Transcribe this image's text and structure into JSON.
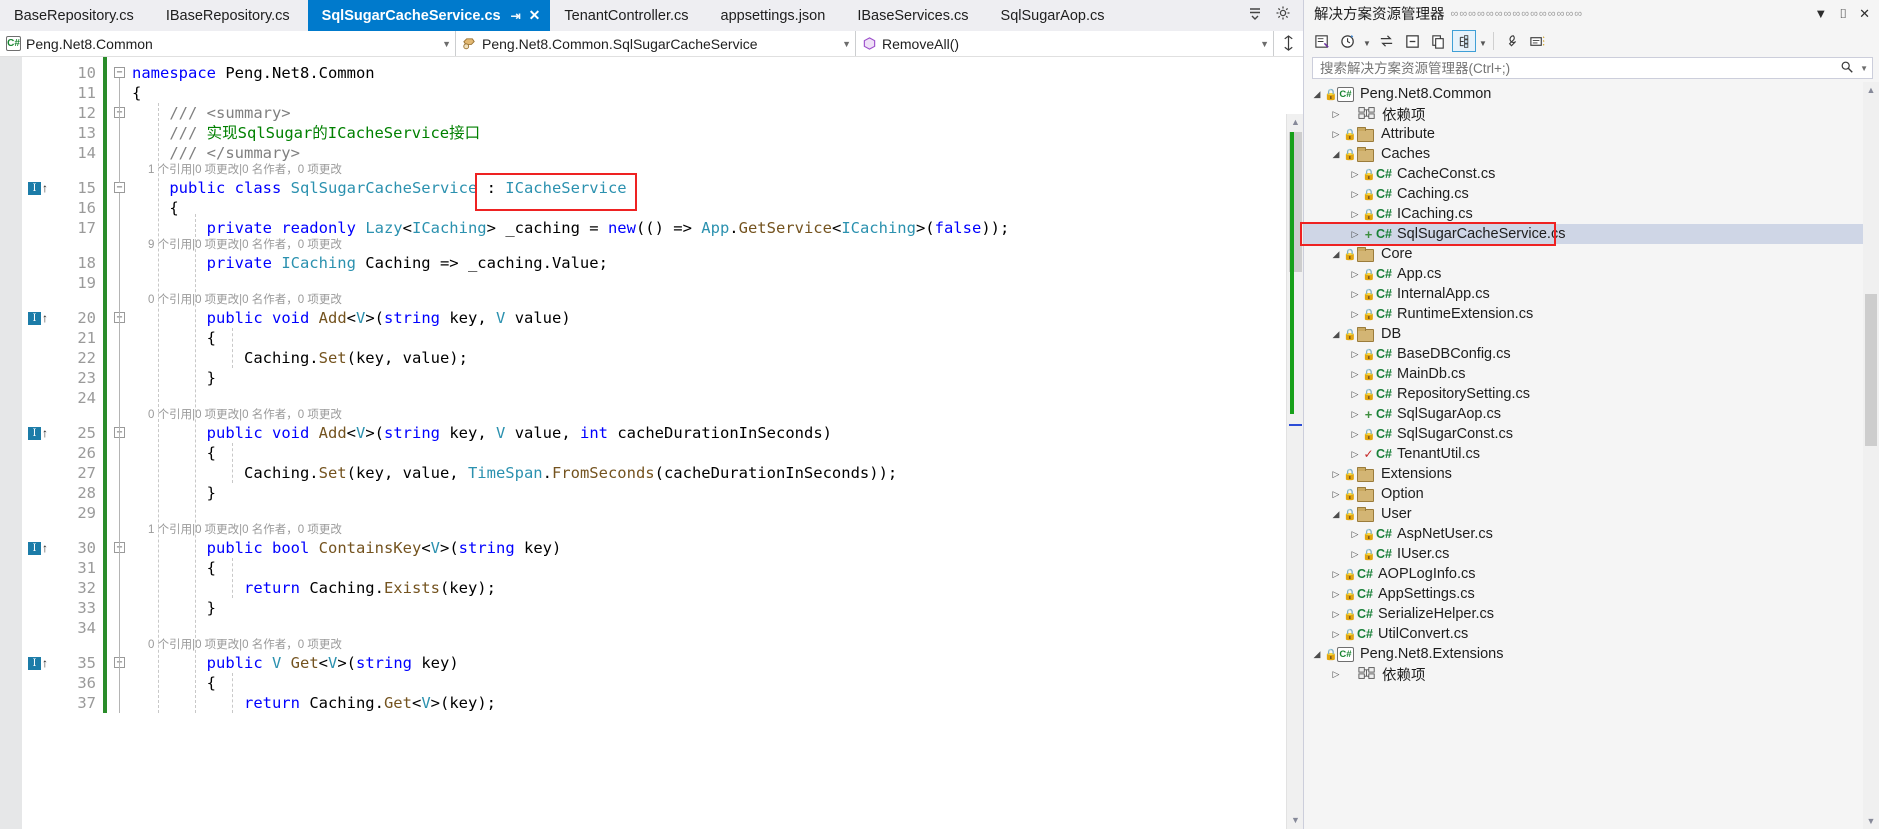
{
  "tabs": [
    {
      "label": "BaseRepository.cs",
      "active": false
    },
    {
      "label": "IBaseRepository.cs",
      "active": false
    },
    {
      "label": "SqlSugarCacheService.cs",
      "active": true
    },
    {
      "label": "TenantController.cs",
      "active": false
    },
    {
      "label": "appsettings.json",
      "active": false
    },
    {
      "label": "IBaseServices.cs",
      "active": false
    },
    {
      "label": "SqlSugarAop.cs",
      "active": false
    }
  ],
  "tab_icons": {
    "pin": "pin-icon",
    "close": "close-icon",
    "overflow": "tab-overflow-icon",
    "settings": "gear-icon"
  },
  "navbar": {
    "project": "Peng.Net8.Common",
    "type": "Peng.Net8.Common.SqlSugarCacheService",
    "member": "RemoveAll()",
    "split_icon": "split-editor-icon"
  },
  "editor": {
    "first_line_number": 10,
    "lines": [
      {
        "n": 10,
        "indicator": false,
        "collapse": "minus",
        "tokens": [
          {
            "t": "namespace ",
            "c": "k"
          },
          {
            "t": "Peng.Net8.Common",
            "c": "pl"
          }
        ]
      },
      {
        "n": 11,
        "indicator": false,
        "collapse": "",
        "tokens": [
          {
            "t": "{",
            "c": "pl"
          }
        ]
      },
      {
        "n": 12,
        "indicator": false,
        "collapse": "minus",
        "tokens": [
          {
            "t": "    /// ",
            "c": "xd"
          },
          {
            "t": "<summary>",
            "c": "xd"
          }
        ]
      },
      {
        "n": 13,
        "indicator": false,
        "collapse": "",
        "tokens": [
          {
            "t": "    /// ",
            "c": "xd"
          },
          {
            "t": "实现SqlSugar的ICacheService接口",
            "c": "cm"
          }
        ]
      },
      {
        "n": 14,
        "indicator": false,
        "collapse": "",
        "tokens": [
          {
            "t": "    /// ",
            "c": "xd"
          },
          {
            "t": "</summary>",
            "c": "xd"
          }
        ]
      },
      {
        "n": 15,
        "indicator": true,
        "collapse": "minus",
        "lens": "1 个引用|0 项更改|0 名作者，0 项更改",
        "tokens": [
          {
            "t": "    ",
            "c": "pl"
          },
          {
            "t": "public ",
            "c": "k"
          },
          {
            "t": "class ",
            "c": "k"
          },
          {
            "t": "SqlSugarCacheService",
            "c": "t"
          },
          {
            "t": " : ",
            "c": "pl"
          },
          {
            "t": "ICacheService",
            "c": "t"
          }
        ]
      },
      {
        "n": 16,
        "indicator": false,
        "collapse": "",
        "tokens": [
          {
            "t": "    {",
            "c": "pl"
          }
        ]
      },
      {
        "n": 17,
        "indicator": false,
        "collapse": "",
        "tokens": [
          {
            "t": "        ",
            "c": "pl"
          },
          {
            "t": "private ",
            "c": "k"
          },
          {
            "t": "readonly ",
            "c": "k"
          },
          {
            "t": "Lazy",
            "c": "t"
          },
          {
            "t": "<",
            "c": "pl"
          },
          {
            "t": "ICaching",
            "c": "t"
          },
          {
            "t": "> ",
            "c": "pl"
          },
          {
            "t": "_caching",
            "c": "pl"
          },
          {
            "t": " = ",
            "c": "pl"
          },
          {
            "t": "new",
            "c": "k"
          },
          {
            "t": "(() => ",
            "c": "pl"
          },
          {
            "t": "App",
            "c": "t"
          },
          {
            "t": ".",
            "c": "pl"
          },
          {
            "t": "GetService",
            "c": "mn"
          },
          {
            "t": "<",
            "c": "pl"
          },
          {
            "t": "ICaching",
            "c": "t"
          },
          {
            "t": ">(",
            "c": "pl"
          },
          {
            "t": "false",
            "c": "k"
          },
          {
            "t": "));",
            "c": "pl"
          }
        ]
      },
      {
        "n": 18,
        "indicator": false,
        "collapse": "",
        "lens": "9 个引用|0 项更改|0 名作者，0 项更改",
        "tokens": [
          {
            "t": "        ",
            "c": "pl"
          },
          {
            "t": "private ",
            "c": "k"
          },
          {
            "t": "ICaching",
            "c": "t"
          },
          {
            "t": " Caching => ",
            "c": "pl"
          },
          {
            "t": "_caching.Value;",
            "c": "pl"
          }
        ]
      },
      {
        "n": 19,
        "indicator": false,
        "collapse": "",
        "tokens": []
      },
      {
        "n": 20,
        "indicator": true,
        "collapse": "minus",
        "lens": "0 个引用|0 项更改|0 名作者，0 项更改",
        "tokens": [
          {
            "t": "        ",
            "c": "pl"
          },
          {
            "t": "public ",
            "c": "k"
          },
          {
            "t": "void ",
            "c": "k"
          },
          {
            "t": "Add",
            "c": "mn"
          },
          {
            "t": "<",
            "c": "pl"
          },
          {
            "t": "V",
            "c": "t"
          },
          {
            "t": ">(",
            "c": "pl"
          },
          {
            "t": "string",
            "c": "k"
          },
          {
            "t": " key, ",
            "c": "pl"
          },
          {
            "t": "V",
            "c": "t"
          },
          {
            "t": " value)",
            "c": "pl"
          }
        ]
      },
      {
        "n": 21,
        "indicator": false,
        "collapse": "",
        "tokens": [
          {
            "t": "        {",
            "c": "pl"
          }
        ]
      },
      {
        "n": 22,
        "indicator": false,
        "collapse": "",
        "tokens": [
          {
            "t": "            Caching.",
            "c": "pl"
          },
          {
            "t": "Set",
            "c": "mn"
          },
          {
            "t": "(key, value);",
            "c": "pl"
          }
        ]
      },
      {
        "n": 23,
        "indicator": false,
        "collapse": "",
        "tokens": [
          {
            "t": "        }",
            "c": "pl"
          }
        ]
      },
      {
        "n": 24,
        "indicator": false,
        "collapse": "",
        "tokens": []
      },
      {
        "n": 25,
        "indicator": true,
        "collapse": "minus",
        "lens": "0 个引用|0 项更改|0 名作者，0 项更改",
        "tokens": [
          {
            "t": "        ",
            "c": "pl"
          },
          {
            "t": "public ",
            "c": "k"
          },
          {
            "t": "void ",
            "c": "k"
          },
          {
            "t": "Add",
            "c": "mn"
          },
          {
            "t": "<",
            "c": "pl"
          },
          {
            "t": "V",
            "c": "t"
          },
          {
            "t": ">(",
            "c": "pl"
          },
          {
            "t": "string",
            "c": "k"
          },
          {
            "t": " key, ",
            "c": "pl"
          },
          {
            "t": "V",
            "c": "t"
          },
          {
            "t": " value, ",
            "c": "pl"
          },
          {
            "t": "int",
            "c": "k"
          },
          {
            "t": " cacheDurationInSeconds)",
            "c": "pl"
          }
        ]
      },
      {
        "n": 26,
        "indicator": false,
        "collapse": "",
        "tokens": [
          {
            "t": "        {",
            "c": "pl"
          }
        ]
      },
      {
        "n": 27,
        "indicator": false,
        "collapse": "",
        "tokens": [
          {
            "t": "            Caching.",
            "c": "pl"
          },
          {
            "t": "Set",
            "c": "mn"
          },
          {
            "t": "(key, value, ",
            "c": "pl"
          },
          {
            "t": "TimeSpan",
            "c": "t"
          },
          {
            "t": ".",
            "c": "pl"
          },
          {
            "t": "FromSeconds",
            "c": "mn"
          },
          {
            "t": "(cacheDurationInSeconds));",
            "c": "pl"
          }
        ]
      },
      {
        "n": 28,
        "indicator": false,
        "collapse": "",
        "tokens": [
          {
            "t": "        }",
            "c": "pl"
          }
        ]
      },
      {
        "n": 29,
        "indicator": false,
        "collapse": "",
        "tokens": []
      },
      {
        "n": 30,
        "indicator": true,
        "collapse": "minus",
        "lens": "1 个引用|0 项更改|0 名作者，0 项更改",
        "tokens": [
          {
            "t": "        ",
            "c": "pl"
          },
          {
            "t": "public ",
            "c": "k"
          },
          {
            "t": "bool ",
            "c": "k"
          },
          {
            "t": "ContainsKey",
            "c": "mn"
          },
          {
            "t": "<",
            "c": "pl"
          },
          {
            "t": "V",
            "c": "t"
          },
          {
            "t": ">(",
            "c": "pl"
          },
          {
            "t": "string",
            "c": "k"
          },
          {
            "t": " key)",
            "c": "pl"
          }
        ]
      },
      {
        "n": 31,
        "indicator": false,
        "collapse": "",
        "tokens": [
          {
            "t": "        {",
            "c": "pl"
          }
        ]
      },
      {
        "n": 32,
        "indicator": false,
        "collapse": "",
        "tokens": [
          {
            "t": "            ",
            "c": "pl"
          },
          {
            "t": "return ",
            "c": "k"
          },
          {
            "t": "Caching.",
            "c": "pl"
          },
          {
            "t": "Exists",
            "c": "mn"
          },
          {
            "t": "(key);",
            "c": "pl"
          }
        ]
      },
      {
        "n": 33,
        "indicator": false,
        "collapse": "",
        "tokens": [
          {
            "t": "        }",
            "c": "pl"
          }
        ]
      },
      {
        "n": 34,
        "indicator": false,
        "collapse": "",
        "tokens": []
      },
      {
        "n": 35,
        "indicator": true,
        "collapse": "minus",
        "lens": "0 个引用|0 项更改|0 名作者，0 项更改",
        "tokens": [
          {
            "t": "        ",
            "c": "pl"
          },
          {
            "t": "public ",
            "c": "k"
          },
          {
            "t": "V ",
            "c": "t"
          },
          {
            "t": "Get",
            "c": "mn"
          },
          {
            "t": "<",
            "c": "pl"
          },
          {
            "t": "V",
            "c": "t"
          },
          {
            "t": ">(",
            "c": "pl"
          },
          {
            "t": "string",
            "c": "k"
          },
          {
            "t": " key)",
            "c": "pl"
          }
        ]
      },
      {
        "n": 36,
        "indicator": false,
        "collapse": "",
        "tokens": [
          {
            "t": "        {",
            "c": "pl"
          }
        ]
      },
      {
        "n": 37,
        "indicator": false,
        "collapse": "",
        "tokens": [
          {
            "t": "            ",
            "c": "pl"
          },
          {
            "t": "return ",
            "c": "k"
          },
          {
            "t": "Caching.",
            "c": "pl"
          },
          {
            "t": "Get",
            "c": "mn"
          },
          {
            "t": "<",
            "c": "pl"
          },
          {
            "t": "V",
            "c": "t"
          },
          {
            "t": ">(key);",
            "c": "pl"
          }
        ]
      }
    ]
  },
  "highlight_boxes": {
    "editor_box_color": "#ee2222",
    "tree_box_color": "#ee2222"
  },
  "solution_explorer": {
    "title": "解决方案资源管理器",
    "header_icons": [
      "chevron-down-icon",
      "pin-icon",
      "close-icon"
    ],
    "toolbar_icons": [
      "home-icon",
      "pending-changes-icon",
      "sync-with-active-document-icon",
      "collapse-all-icon",
      "copy-icon",
      "show-all-files-icon",
      "properties-icon",
      "preview-icon"
    ],
    "search_placeholder": "搜索解决方案资源管理器(Ctrl+;)",
    "search_value": "",
    "tree": [
      {
        "depth": 0,
        "expander": "expanded",
        "status": "lock",
        "icon": "project",
        "label": "Peng.Net8.Common",
        "selected": false
      },
      {
        "depth": 1,
        "expander": "collapsed",
        "status": "none",
        "icon": "dependencies",
        "label": "依赖项",
        "selected": false
      },
      {
        "depth": 1,
        "expander": "collapsed",
        "status": "lock",
        "icon": "folder",
        "label": "Attribute",
        "selected": false
      },
      {
        "depth": 1,
        "expander": "expanded",
        "status": "lock",
        "icon": "folder",
        "label": "Caches",
        "selected": false
      },
      {
        "depth": 2,
        "expander": "collapsed",
        "status": "lock",
        "icon": "cs",
        "label": "CacheConst.cs",
        "selected": false
      },
      {
        "depth": 2,
        "expander": "collapsed",
        "status": "lock",
        "icon": "cs",
        "label": "Caching.cs",
        "selected": false
      },
      {
        "depth": 2,
        "expander": "collapsed",
        "status": "lock",
        "icon": "cs",
        "label": "ICaching.cs",
        "selected": false
      },
      {
        "depth": 2,
        "expander": "collapsed",
        "status": "plus",
        "icon": "cs",
        "label": "SqlSugarCacheService.cs",
        "selected": true
      },
      {
        "depth": 1,
        "expander": "expanded",
        "status": "lock",
        "icon": "folder",
        "label": "Core",
        "selected": false
      },
      {
        "depth": 2,
        "expander": "collapsed",
        "status": "lock",
        "icon": "cs",
        "label": "App.cs",
        "selected": false
      },
      {
        "depth": 2,
        "expander": "collapsed",
        "status": "lock",
        "icon": "cs",
        "label": "InternalApp.cs",
        "selected": false
      },
      {
        "depth": 2,
        "expander": "collapsed",
        "status": "lock",
        "icon": "cs",
        "label": "RuntimeExtension.cs",
        "selected": false
      },
      {
        "depth": 1,
        "expander": "expanded",
        "status": "lock",
        "icon": "folder",
        "label": "DB",
        "selected": false
      },
      {
        "depth": 2,
        "expander": "collapsed",
        "status": "lock",
        "icon": "cs",
        "label": "BaseDBConfig.cs",
        "selected": false
      },
      {
        "depth": 2,
        "expander": "collapsed",
        "status": "lock",
        "icon": "cs",
        "label": "MainDb.cs",
        "selected": false
      },
      {
        "depth": 2,
        "expander": "collapsed",
        "status": "lock",
        "icon": "cs",
        "label": "RepositorySetting.cs",
        "selected": false
      },
      {
        "depth": 2,
        "expander": "collapsed",
        "status": "plus",
        "icon": "cs",
        "label": "SqlSugarAop.cs",
        "selected": false
      },
      {
        "depth": 2,
        "expander": "collapsed",
        "status": "lock",
        "icon": "cs",
        "label": "SqlSugarConst.cs",
        "selected": false
      },
      {
        "depth": 2,
        "expander": "collapsed",
        "status": "check",
        "icon": "cs",
        "label": "TenantUtil.cs",
        "selected": false
      },
      {
        "depth": 1,
        "expander": "collapsed",
        "status": "lock",
        "icon": "folder",
        "label": "Extensions",
        "selected": false
      },
      {
        "depth": 1,
        "expander": "collapsed",
        "status": "lock",
        "icon": "folder",
        "label": "Option",
        "selected": false
      },
      {
        "depth": 1,
        "expander": "expanded",
        "status": "lock",
        "icon": "folder",
        "label": "User",
        "selected": false
      },
      {
        "depth": 2,
        "expander": "collapsed",
        "status": "lock",
        "icon": "cs",
        "label": "AspNetUser.cs",
        "selected": false
      },
      {
        "depth": 2,
        "expander": "collapsed",
        "status": "lock",
        "icon": "cs",
        "label": "IUser.cs",
        "selected": false
      },
      {
        "depth": 1,
        "expander": "collapsed",
        "status": "lock",
        "icon": "cs",
        "label": "AOPLogInfo.cs",
        "selected": false
      },
      {
        "depth": 1,
        "expander": "collapsed",
        "status": "lock",
        "icon": "cs",
        "label": "AppSettings.cs",
        "selected": false
      },
      {
        "depth": 1,
        "expander": "collapsed",
        "status": "lock",
        "icon": "cs",
        "label": "SerializeHelper.cs",
        "selected": false
      },
      {
        "depth": 1,
        "expander": "collapsed",
        "status": "lock",
        "icon": "cs",
        "label": "UtilConvert.cs",
        "selected": false
      },
      {
        "depth": 0,
        "expander": "expanded",
        "status": "lock",
        "icon": "project",
        "label": "Peng.Net8.Extensions",
        "selected": false
      },
      {
        "depth": 1,
        "expander": "collapsed",
        "status": "none",
        "icon": "dependencies",
        "label": "依赖项",
        "selected": false
      }
    ]
  }
}
